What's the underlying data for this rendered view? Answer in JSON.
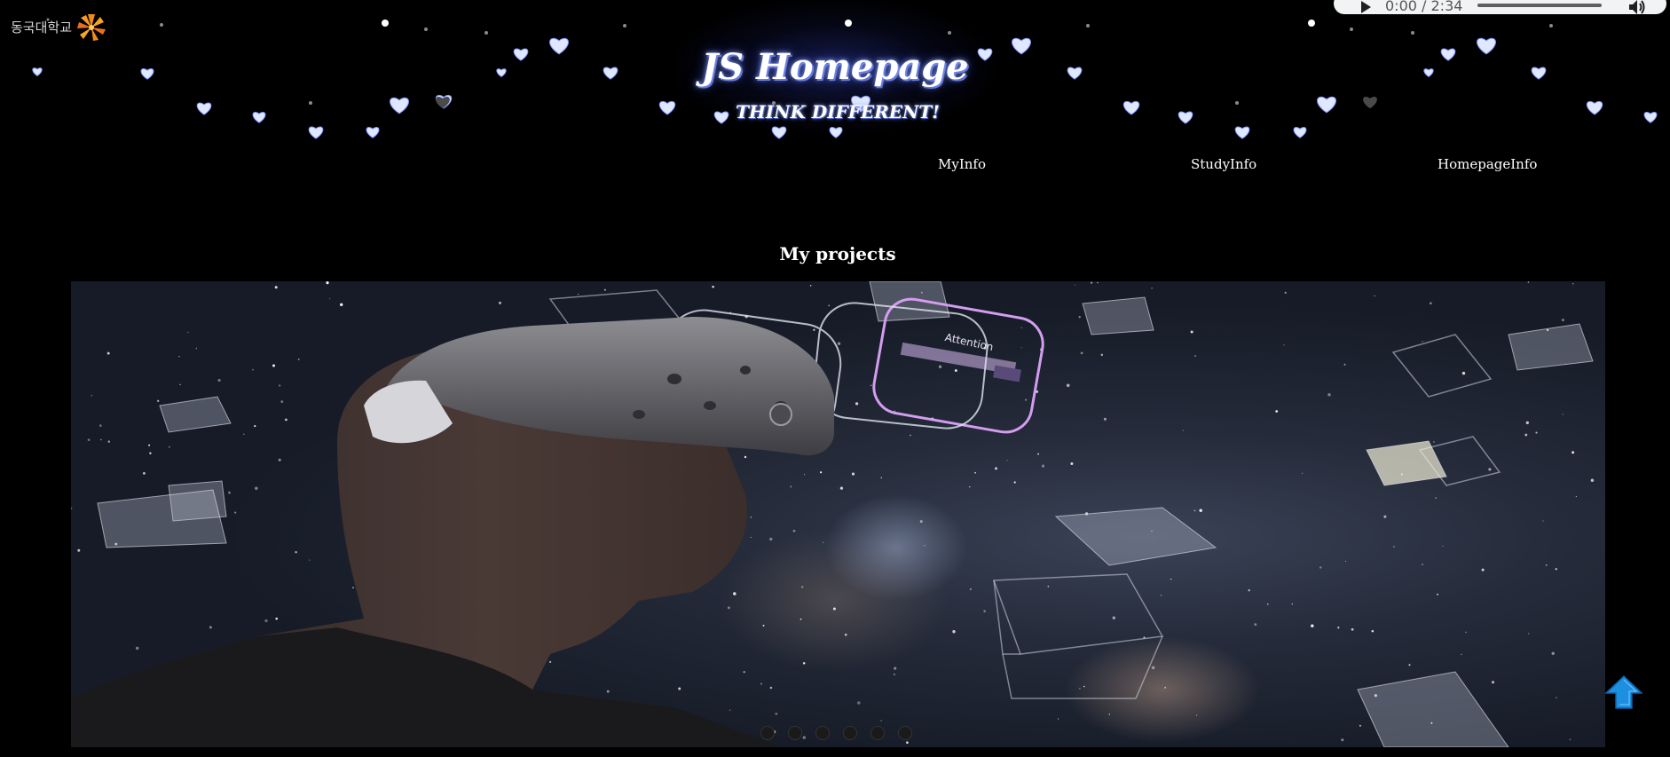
{
  "header": {
    "logo_text": "동국대학교",
    "logo_icon": "dongguk-emblem-icon",
    "title": "JS Homepage",
    "slogan": "THINK DIFFERENT!"
  },
  "audio_player": {
    "time": "0:00 / 2:34",
    "play_icon": "play-icon",
    "volume_icon": "volume-icon",
    "progress": 0
  },
  "nav": {
    "items": [
      {
        "label": "MyInfo"
      },
      {
        "label": "StudyInfo"
      },
      {
        "label": "HomepageInfo"
      }
    ]
  },
  "projects": {
    "heading": "My projects",
    "slide_label": "Attention",
    "slide_count": 6,
    "active_slide": 1
  },
  "scroll_top": {
    "icon": "arrow-up-icon"
  },
  "colors": {
    "background": "#000000",
    "heart": "#dfe8ff",
    "title_glow": "#8ea8ff",
    "top_arrow": "#1c8fe0"
  }
}
